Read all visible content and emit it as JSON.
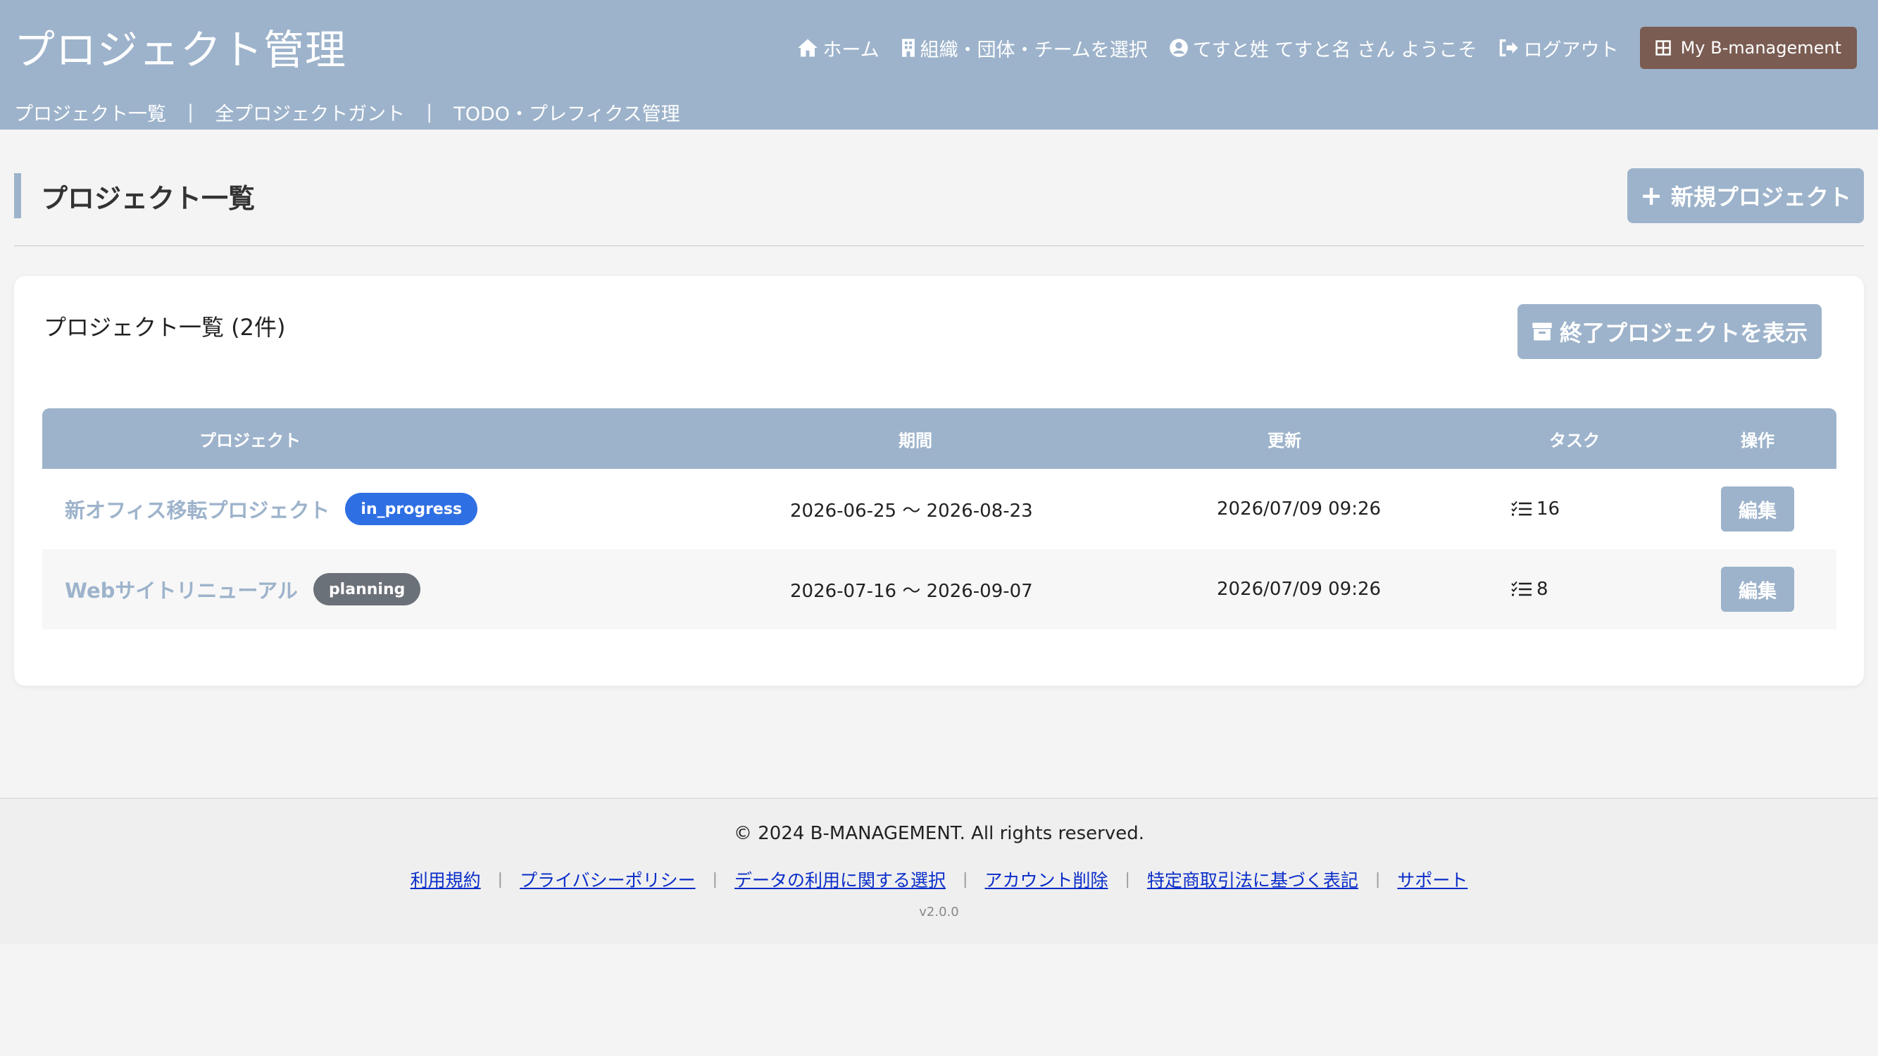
{
  "header": {
    "app_title": "プロジェクト管理",
    "nav": {
      "home": "ホーム",
      "select_org": "組織・団体・チームを選択",
      "welcome": "てすと姓 てすと名 さん ようこそ",
      "logout": "ログアウト",
      "my_bm": "My B-management"
    },
    "subnav": {
      "projects": "プロジェクト一覧",
      "gantt": "全プロジェクトガント",
      "todo": "TODO・プレフィクス管理",
      "separator": "|"
    }
  },
  "page": {
    "heading": "プロジェクト一覧",
    "new_button": "新規プロジェクト",
    "new_button_icon": "+"
  },
  "card": {
    "title": "プロジェクト一覧 (2件)",
    "ended_button": "終了プロジェクトを表示"
  },
  "table": {
    "headers": {
      "project": "プロジェクト",
      "period": "期間",
      "updated": "更新",
      "tasks": "タスク",
      "actions": "操作"
    },
    "rows": [
      {
        "name": "新オフィス移転プロジェクト",
        "status": "in_progress",
        "status_color": "#2f6fe4",
        "period": "2026-06-25 〜 2026-08-23",
        "updated": "2026/07/09 09:26",
        "tasks": "16",
        "edit": "編集"
      },
      {
        "name": "Webサイトリニューアル",
        "status": "planning",
        "status_color": "#6b7178",
        "period": "2026-07-16 〜 2026-09-07",
        "updated": "2026/07/09 09:26",
        "tasks": "8",
        "edit": "編集"
      }
    ]
  },
  "footer": {
    "copyright": "© 2024 B-MANAGEMENT. All rights reserved.",
    "links": [
      "利用規約",
      "プライバシーポリシー",
      "データの利用に関する選択",
      "アカウント削除",
      "特定商取引法に基づく表記",
      "サポート"
    ],
    "separator": "|",
    "version": "v2.0.0"
  },
  "colors": {
    "primary": "#9db3cb",
    "brand_button": "#7a5c52",
    "link": "#0a2dc9"
  }
}
